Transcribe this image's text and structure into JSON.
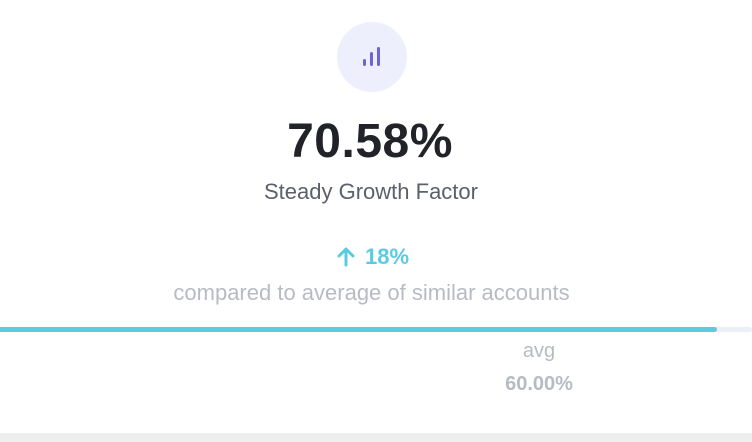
{
  "metric": {
    "icon": "bar-chart-icon",
    "value": "70.58%",
    "label": "Steady Growth Factor"
  },
  "comparison": {
    "direction": "up",
    "icon": "arrow-up-icon",
    "change": "18%",
    "text": "compared to average of similar accounts"
  },
  "progress": {
    "value_percent": 70.58,
    "max_percent": 74.0
  },
  "average": {
    "label": "avg",
    "value": "60.00%"
  },
  "colors": {
    "accent": "#5bcbe0",
    "icon_purple": "#6f63d8",
    "icon_bg": "#eeeffd",
    "primary_text": "#222328",
    "secondary_text": "#5d5f6b",
    "muted_text": "#b9bbc4",
    "track": "#eaf0f6"
  }
}
